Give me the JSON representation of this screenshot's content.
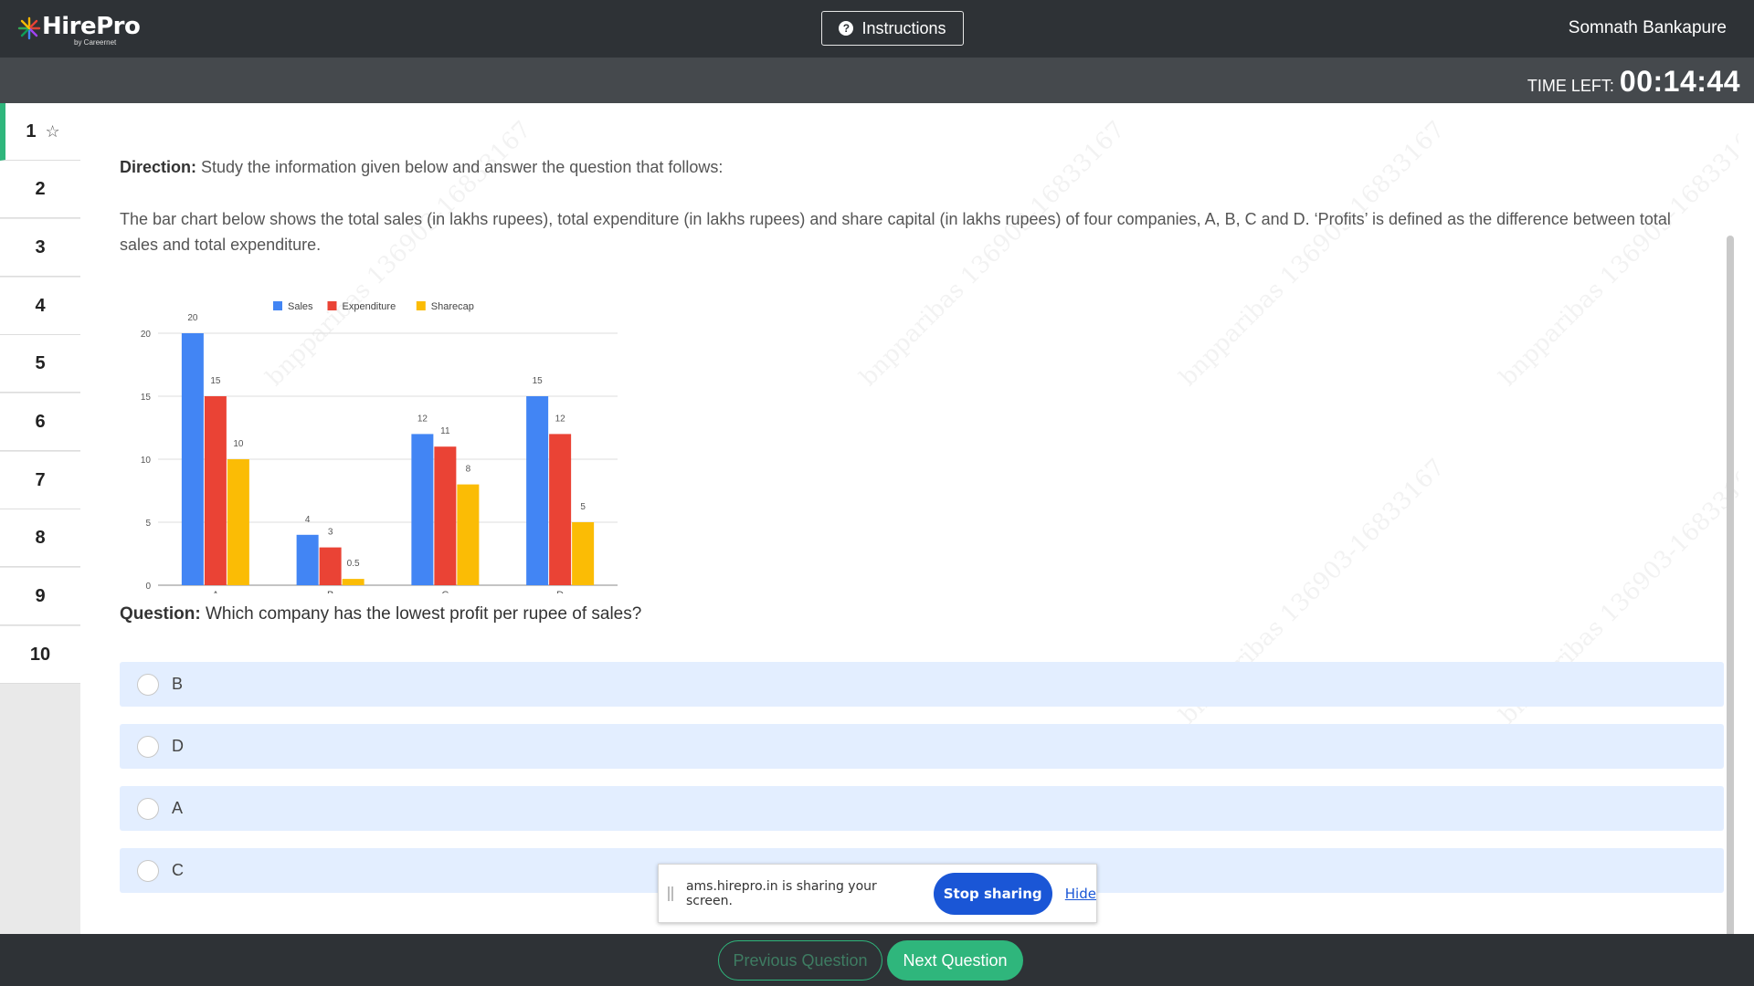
{
  "header": {
    "logo_text": "HirePro",
    "logo_tagline": "by Careernet",
    "instructions_label": "Instructions",
    "user_name": "Somnath Bankapure"
  },
  "timer": {
    "label": "TIME LEFT:",
    "value": "00:14:44"
  },
  "sidebar": {
    "questions": [
      "1",
      "2",
      "3",
      "4",
      "5",
      "6",
      "7",
      "8",
      "9",
      "10"
    ],
    "active": "1"
  },
  "content": {
    "direction_label": "Direction:",
    "direction_text": "Study the information given below and answer the question that follows:",
    "passage": "The bar chart below shows the total sales (in lakhs rupees), total expenditure (in lakhs rupees) and share capital (in lakhs rupees) of four companies, A, B, C and D. ‘Profits’ is defined as the difference between total sales and total expenditure.",
    "question_label": "Question:",
    "question_text": "Which company has the lowest profit per rupee of sales?",
    "options": [
      "B",
      "D",
      "A",
      "C"
    ]
  },
  "chart_data": {
    "type": "bar",
    "categories": [
      "A",
      "B",
      "C",
      "D"
    ],
    "series": [
      {
        "name": "Sales",
        "values": [
          20,
          4,
          12,
          15
        ],
        "color": "#4285f4"
      },
      {
        "name": "Expenditure",
        "values": [
          15,
          3,
          11,
          12
        ],
        "color": "#ea4335"
      },
      {
        "name": "Sharecap",
        "values": [
          10,
          0.5,
          8,
          5
        ],
        "color": "#fbbc05"
      }
    ],
    "ylim": [
      0,
      20
    ],
    "yticks": [
      0,
      5,
      10,
      15,
      20
    ],
    "grid": true,
    "legend": "top",
    "data_labels": true
  },
  "screen_share": {
    "message": "ams.hirepro.in is sharing your screen.",
    "stop_label": "Stop sharing",
    "hide_label": "Hide"
  },
  "footer": {
    "prev_label": "Previous Question",
    "next_label": "Next Question"
  },
  "colors": {
    "accent": "#2fb67c",
    "header_bg": "#2e3236",
    "option_bg": "#e3eeff",
    "share_button": "#1a56d6"
  }
}
